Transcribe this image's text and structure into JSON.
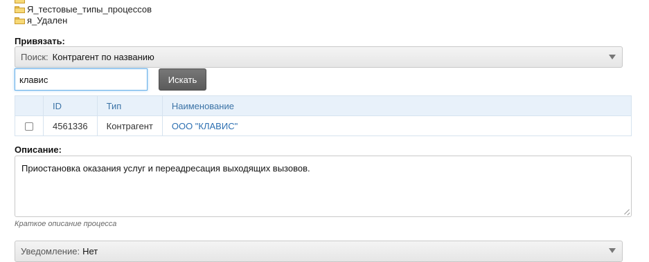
{
  "tree": {
    "items": [
      {
        "label": "Я_тестовые_типы_процессов"
      },
      {
        "label": "я_Удален"
      }
    ]
  },
  "bind": {
    "label": "Привязать:",
    "search_prefix": "Поиск:",
    "search_type": "Контрагент по названию",
    "search_value": "клавис",
    "search_button": "Искать"
  },
  "results": {
    "columns": [
      "ID",
      "Тип",
      "Наименование"
    ],
    "rows": [
      {
        "id": "4561336",
        "type": "Контрагент",
        "name": "ООО \"КЛАВИС\"",
        "checked": false
      }
    ]
  },
  "description": {
    "label": "Описание:",
    "value": "Приостановка оказания услуг и переадресация выходящих вызовов.",
    "hint": "Краткое описание процесса"
  },
  "notification": {
    "label": "Уведомление:",
    "value": "Нет"
  }
}
